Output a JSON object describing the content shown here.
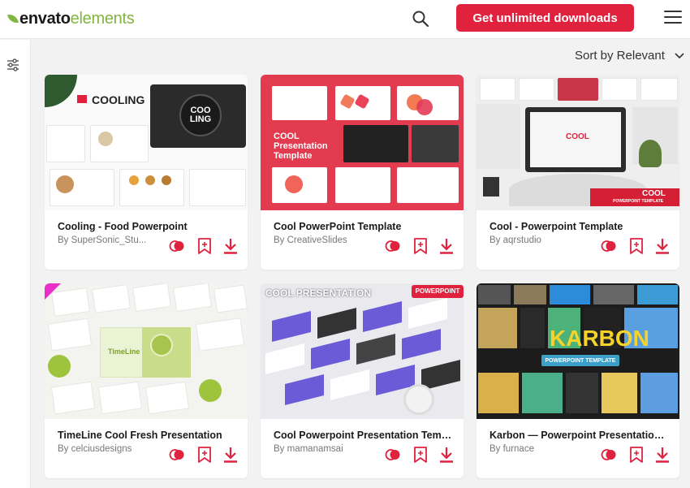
{
  "header": {
    "logo_dark": "envato",
    "logo_light": "elements",
    "cta_label": "Get unlimited downloads"
  },
  "sort": {
    "label": "Sort by Relevant"
  },
  "colors": {
    "accent": "#e0223f",
    "brand_green": "#82b541"
  },
  "icons": [
    "search-icon",
    "menu-icon",
    "filter-icon",
    "chevron-down-icon",
    "collection-icon",
    "bookmark-add-icon",
    "download-icon"
  ],
  "cards": [
    {
      "title": "Cooling - Food Powerpoint",
      "author": "By SuperSonic_Stu...",
      "thumb_title": "COOLING",
      "thumb_badge": "COO LING"
    },
    {
      "title": "Cool PowerPoint Template",
      "author": "By CreativeSlides",
      "thumb_title": "COOL Presentation Template"
    },
    {
      "title": "Cool - Powerpoint Template",
      "author": "By aqrstudio",
      "thumb_title": "COOL",
      "thumb_sub": "POWERPOINT TEMPLATE"
    },
    {
      "title": "TimeLine Cool Fresh Presentation",
      "author": "By celciusdesigns",
      "thumb_title": "TimeLine"
    },
    {
      "title": "Cool Powerpoint Presentation Templ...",
      "author": "By mamanamsai",
      "thumb_title": "COOL PRESENTATION",
      "thumb_badge": "POWERPOINT"
    },
    {
      "title": "Karbon — Powerpoint Presentation T...",
      "author": "By furnace",
      "thumb_title": "KARBON",
      "thumb_sub": "POWERPOINT TEMPLATE"
    }
  ]
}
